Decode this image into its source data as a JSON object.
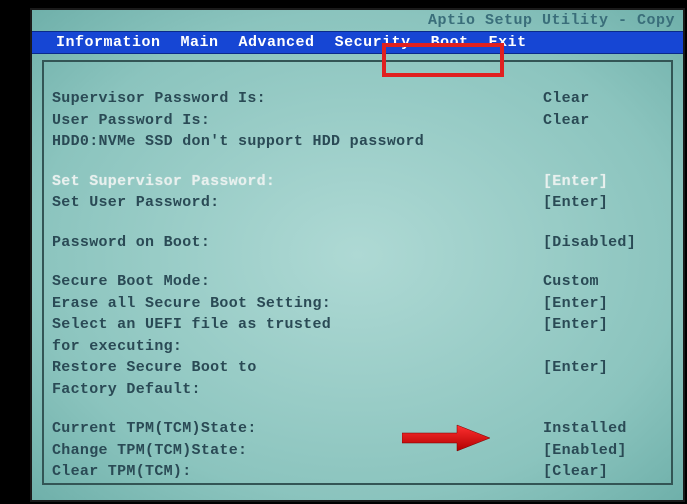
{
  "title_bar": "Aptio Setup Utility - Copy",
  "menu": {
    "items": [
      "Information",
      "Main",
      "Advanced",
      "Security",
      "Boot",
      "Exit"
    ],
    "selected_index": 3
  },
  "status": {
    "supervisor": {
      "label": "Supervisor Password Is:",
      "value": "Clear"
    },
    "user": {
      "label": "User Password Is:",
      "value": "Clear"
    },
    "hdd0": "HDD0:NVMe SSD don't support HDD password"
  },
  "passwords": {
    "set_supervisor": {
      "label": "Set Supervisor Password:",
      "value": "[Enter]"
    },
    "set_user": {
      "label": "Set User Password:",
      "value": "[Enter]"
    }
  },
  "password_on_boot": {
    "label": "Password on Boot:",
    "value": "[Disabled]"
  },
  "secure_boot": {
    "mode": {
      "label": "Secure Boot Mode:",
      "value": "Custom"
    },
    "erase": {
      "label": "Erase all Secure Boot Setting:",
      "value": "[Enter]"
    },
    "select_uefi": {
      "label": "Select an UEFI file as trusted",
      "value": "[Enter]"
    },
    "select_uefi2": "for executing:",
    "restore": {
      "label": "Restore Secure Boot to",
      "value": "[Enter]"
    },
    "restore2": "Factory Default:"
  },
  "tpm": {
    "current": {
      "label": "Current TPM(TCM)State:",
      "value": "Installed"
    },
    "change": {
      "label": "Change TPM(TCM)State:",
      "value": "[Enabled]"
    },
    "clear": {
      "label": "Clear TPM(TCM):",
      "value": "[Clear]"
    }
  }
}
